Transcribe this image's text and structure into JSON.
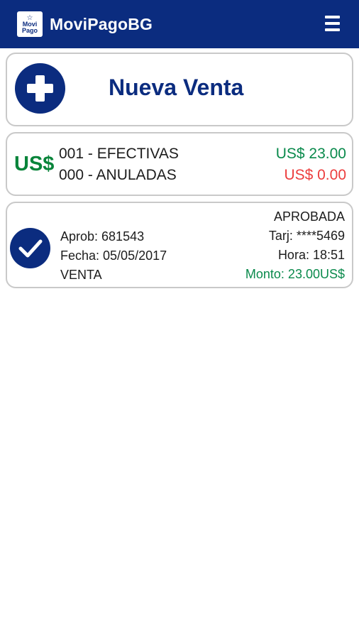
{
  "app": {
    "title": "MoviPagoBG",
    "logo_lines": [
      "Movi",
      "Pago"
    ],
    "brand_color": "#0b2c7f",
    "menu_icon": "hamburger-menu-icon"
  },
  "new_sale": {
    "icon": "plus-circle-icon",
    "label": "Nueva Venta"
  },
  "summary": {
    "currency": "US$",
    "rows": [
      {
        "label": "001 - EFECTIVAS",
        "amount": "US$ 23.00",
        "color": "#0a8a4c"
      },
      {
        "label": "000 - ANULADAS",
        "amount": "US$ 0.00",
        "color": "#ec3d3d"
      }
    ]
  },
  "transaction": {
    "icon": "check-circle-icon",
    "status": "APROBADA",
    "approval": "Aprob: 681543",
    "date": "Fecha: 05/05/2017",
    "type": "VENTA",
    "card": "Tarj: ****5469",
    "time": "Hora: 18:51",
    "amount": "Monto: 23.00US$",
    "amount_color": "#0a8a4c"
  }
}
